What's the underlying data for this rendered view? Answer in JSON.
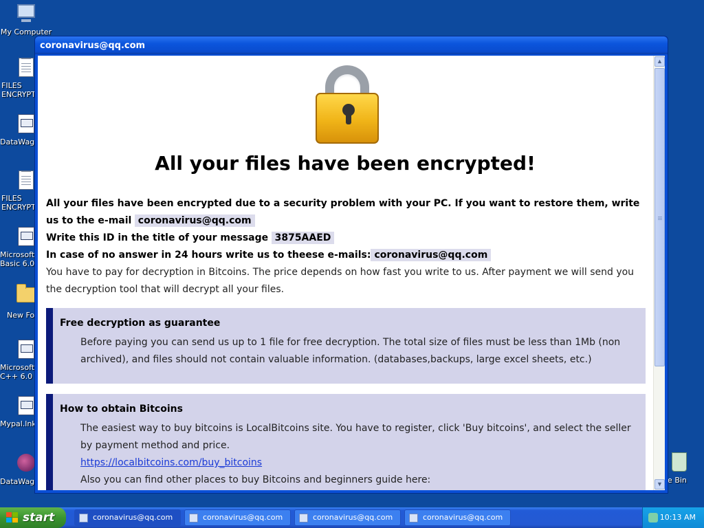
{
  "desktop": {
    "icons": [
      {
        "label": "My Computer"
      },
      {
        "label": "FILES ENCRYPT"
      },
      {
        "label": "DataWago"
      },
      {
        "label": "FILES ENCRYPT"
      },
      {
        "label": "Microsoft Basic 6.0"
      },
      {
        "label": "New Fol"
      },
      {
        "label": "Microsoft C++ 6.0"
      },
      {
        "label": "Mypal.lnk"
      },
      {
        "label": "DataWago"
      },
      {
        "label": "le Bin"
      }
    ]
  },
  "window": {
    "title": "coronavirus@qq.com",
    "heading": "All your files have been encrypted!",
    "intro_part1": "All your files have been encrypted due to a security problem with your PC. If you want to restore them, write us to the e-mail",
    "email": "coronavirus@qq.com",
    "id_label": "Write this ID in the title of your message",
    "id_value": "3875AAED",
    "noanswer_label": "In case of no answer in 24 hours write us to theese e-mails:",
    "email2": "coronavirus@qq.com",
    "payment_text": "You have to pay for decryption in Bitcoins. The price depends on how fast you write to us. After payment we will send you the decryption tool that will decrypt all your files.",
    "notes": [
      {
        "title": "Free decryption as guarantee",
        "body": "Before paying you can send us up to 1 file for free decryption. The total size of files must be less than 1Mb (non archived), and files should not contain valuable information. (databases,backups, large excel sheets, etc.)"
      },
      {
        "title": "How to obtain Bitcoins",
        "body": "The easiest way to buy bitcoins is LocalBitcoins site. You have to register, click 'Buy bitcoins', and select the seller by payment method and price.",
        "link": "https://localbitcoins.com/buy_bitcoins",
        "more": "Also you can find other places to buy Bitcoins and beginners guide here:"
      }
    ]
  },
  "taskbar": {
    "start_label": "start",
    "tasks": [
      {
        "label": "coronavirus@qq.com"
      },
      {
        "label": "coronavirus@qq.com"
      },
      {
        "label": "coronavirus@qq.com"
      },
      {
        "label": "coronavirus@qq.com"
      }
    ],
    "clock": "10:13 AM"
  }
}
